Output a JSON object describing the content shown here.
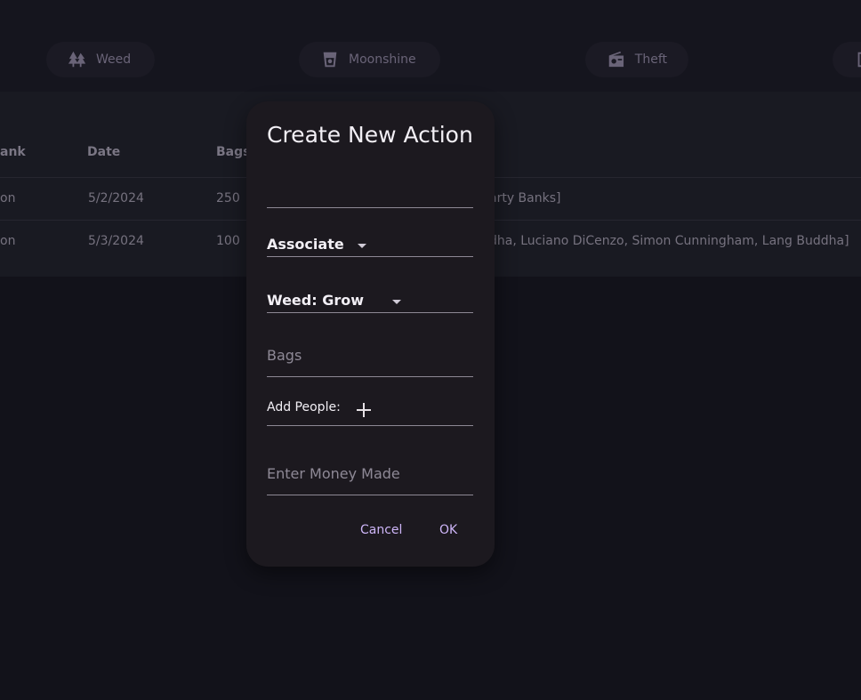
{
  "tabs": [
    {
      "label": "Weed",
      "icon": "trees-icon"
    },
    {
      "label": "Moonshine",
      "icon": "cup-icon"
    },
    {
      "label": "Theft",
      "icon": "radio-icon"
    }
  ],
  "table": {
    "headers": [
      "ank",
      "Date",
      "Bags"
    ],
    "rows": [
      {
        "c0": "on",
        "date": "5/2/2024",
        "bags": "250",
        "people": "arty Banks]"
      },
      {
        "c0": "on",
        "date": "5/3/2024",
        "bags": "100",
        "people": "dha, Luciano DiCenzo, Simon Cunningham, Lang Buddha]"
      }
    ]
  },
  "dialog": {
    "title": "Create New Action",
    "rank_value": "Associate",
    "type_value": "Weed: Grow",
    "bags_placeholder": "Bags",
    "add_people_label": "Add People:",
    "money_placeholder": "Enter Money Made",
    "cancel_label": "Cancel",
    "ok_label": "OK"
  },
  "colors": {
    "accent": "#cdb5f7",
    "background": "#12121a",
    "dialog": "#1c191f"
  }
}
